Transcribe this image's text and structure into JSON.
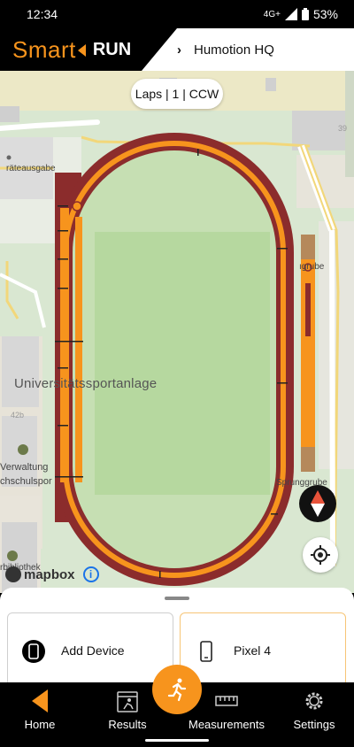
{
  "status": {
    "time": "12:34",
    "network": "4G+",
    "battery": "53%"
  },
  "header": {
    "logo_smart": "Smart",
    "logo_run": "RUN",
    "location": "Humotion HQ",
    "accent": "#f7941d"
  },
  "map": {
    "laps_pill": "Laps | 1 | CCW",
    "labels": {
      "geraeteausgabe": "räteausgabe",
      "sprunggrube1": "ıgrube",
      "sportanlage": "Universitätssportanlage",
      "verwaltung": "Verwaltung",
      "hochschulsport": "chschulspor",
      "sprunggrube2": "Sprunggrube",
      "bibliothek": "rbibliothek",
      "num39": "39",
      "num42b": "42b"
    },
    "attribution": "mapbox",
    "info_icon": "i"
  },
  "sheet": {
    "cards": [
      {
        "label": "Add Device",
        "icon": "phone-icon"
      },
      {
        "label": "Pixel 4",
        "icon": "phone-outline-icon"
      }
    ]
  },
  "nav": {
    "items": [
      {
        "label": "Home",
        "icon": "home-icon"
      },
      {
        "label": "Results",
        "icon": "results-icon"
      },
      {
        "label": "Measurements",
        "icon": "ruler-icon"
      },
      {
        "label": "Settings",
        "icon": "gear-icon"
      }
    ]
  }
}
